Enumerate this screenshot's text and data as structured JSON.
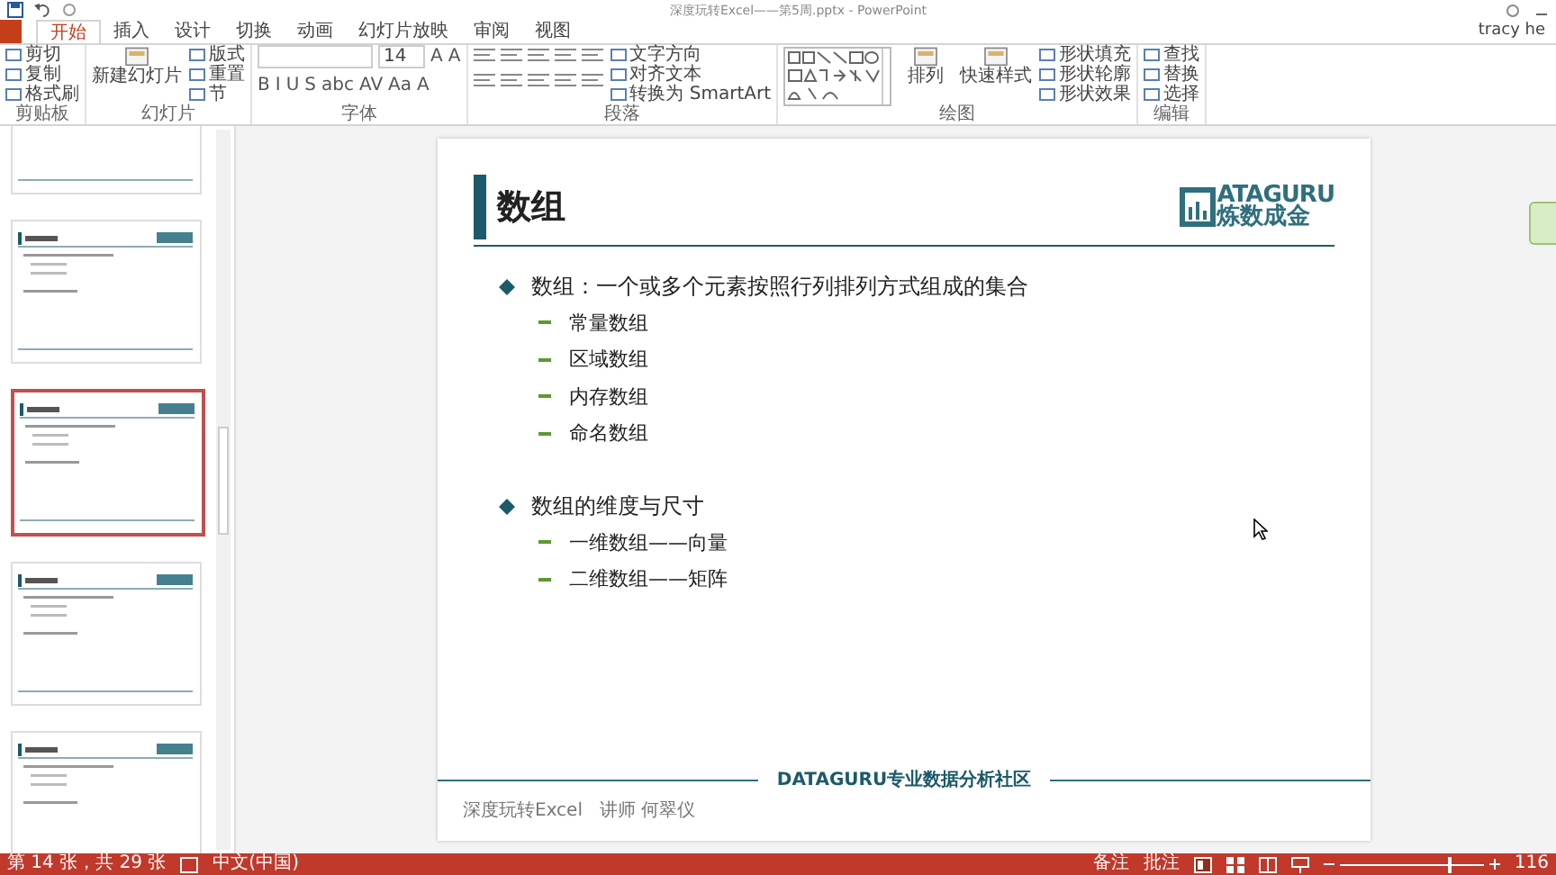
{
  "window": {
    "title": "深度玩转Excel——第5周.pptx - PowerPoint",
    "user": "tracy he"
  },
  "tabs": [
    {
      "label": "开始",
      "selected": true
    },
    {
      "label": "插入",
      "selected": false
    },
    {
      "label": "设计",
      "selected": false
    },
    {
      "label": "切换",
      "selected": false
    },
    {
      "label": "动画",
      "selected": false
    },
    {
      "label": "幻灯片放映",
      "selected": false
    },
    {
      "label": "审阅",
      "selected": false
    },
    {
      "label": "视图",
      "selected": false
    }
  ],
  "ribbon": [
    {
      "label": "剪贴板",
      "columns": [
        {
          "kind": "stack",
          "items": [
            {
              "kind": "small",
              "label": "剪切"
            },
            {
              "kind": "small",
              "label": "复制"
            },
            {
              "kind": "small",
              "label": "格式刷"
            }
          ]
        }
      ]
    },
    {
      "label": "幻灯片",
      "columns": [
        {
          "kind": "large",
          "label": "新建幻灯片"
        },
        {
          "kind": "stack",
          "items": [
            {
              "kind": "small",
              "label": "版式"
            },
            {
              "kind": "small",
              "label": "重置"
            },
            {
              "kind": "small",
              "label": "节"
            }
          ]
        }
      ]
    },
    {
      "label": "字体",
      "columns": [
        {
          "kind": "stack",
          "items": [
            {
              "kind": "row",
              "parts": [
                {
                  "kind": "field"
                },
                {
                  "kind": "field",
                  "value": "14"
                },
                {
                  "kind": "glyphs",
                  "labels": [
                    "A",
                    "A"
                  ]
                }
              ]
            },
            {
              "kind": "glyphs",
              "labels": [
                "B",
                "I",
                "U",
                "S",
                "abc",
                "AV",
                "Aa",
                "A"
              ]
            }
          ]
        }
      ]
    },
    {
      "label": "段落",
      "columns": [
        {
          "kind": "stack",
          "items": [
            {
              "kind": "icons"
            },
            {
              "kind": "icons"
            }
          ]
        },
        {
          "kind": "stack",
          "items": [
            {
              "kind": "small",
              "label": "文字方向"
            },
            {
              "kind": "small",
              "label": "对齐文本"
            },
            {
              "kind": "small",
              "label": "转换为 SmartArt"
            }
          ]
        }
      ]
    },
    {
      "label": "绘图",
      "columns": [
        {
          "kind": "shapes"
        },
        {
          "kind": "large",
          "label": "排列"
        },
        {
          "kind": "large",
          "label": "快速样式"
        },
        {
          "kind": "stack",
          "items": [
            {
              "kind": "small",
              "label": "形状填充"
            },
            {
              "kind": "small",
              "label": "形状轮廓"
            },
            {
              "kind": "small",
              "label": "形状效果"
            }
          ]
        }
      ]
    },
    {
      "label": "编辑",
      "columns": [
        {
          "kind": "stack",
          "items": [
            {
              "kind": "small",
              "label": "查找"
            },
            {
              "kind": "small",
              "label": "替换"
            },
            {
              "kind": "small",
              "label": "选择"
            }
          ]
        }
      ]
    }
  ],
  "thumbnails": [
    {
      "selected": false
    },
    {
      "selected": false
    },
    {
      "selected": true
    },
    {
      "selected": false
    },
    {
      "selected": false
    }
  ],
  "slide": {
    "title": "数组",
    "logo_top": "ATAGURU",
    "logo_bottom": "炼数成金",
    "groups": [
      {
        "text": "数组：一个或多个元素按照行列排列方式组成的集合",
        "items": [
          "常量数组",
          "区域数组",
          "内存数组",
          "命名数组"
        ]
      },
      {
        "text": "数组的维度与尺寸",
        "items": [
          "一维数组——向量",
          "二维数组——矩阵"
        ]
      }
    ],
    "footer_center": "DATAGURU专业数据分析社区",
    "footer_left": "深度玩转Excel   讲师 何翠仪"
  },
  "status_bar": {
    "slide_position": "第 14 张，共 29 张",
    "language": "中文(中国)",
    "notes": "备注",
    "comments": "批注",
    "zoom": {
      "level": 0.75
    },
    "zoom_text": "116"
  }
}
